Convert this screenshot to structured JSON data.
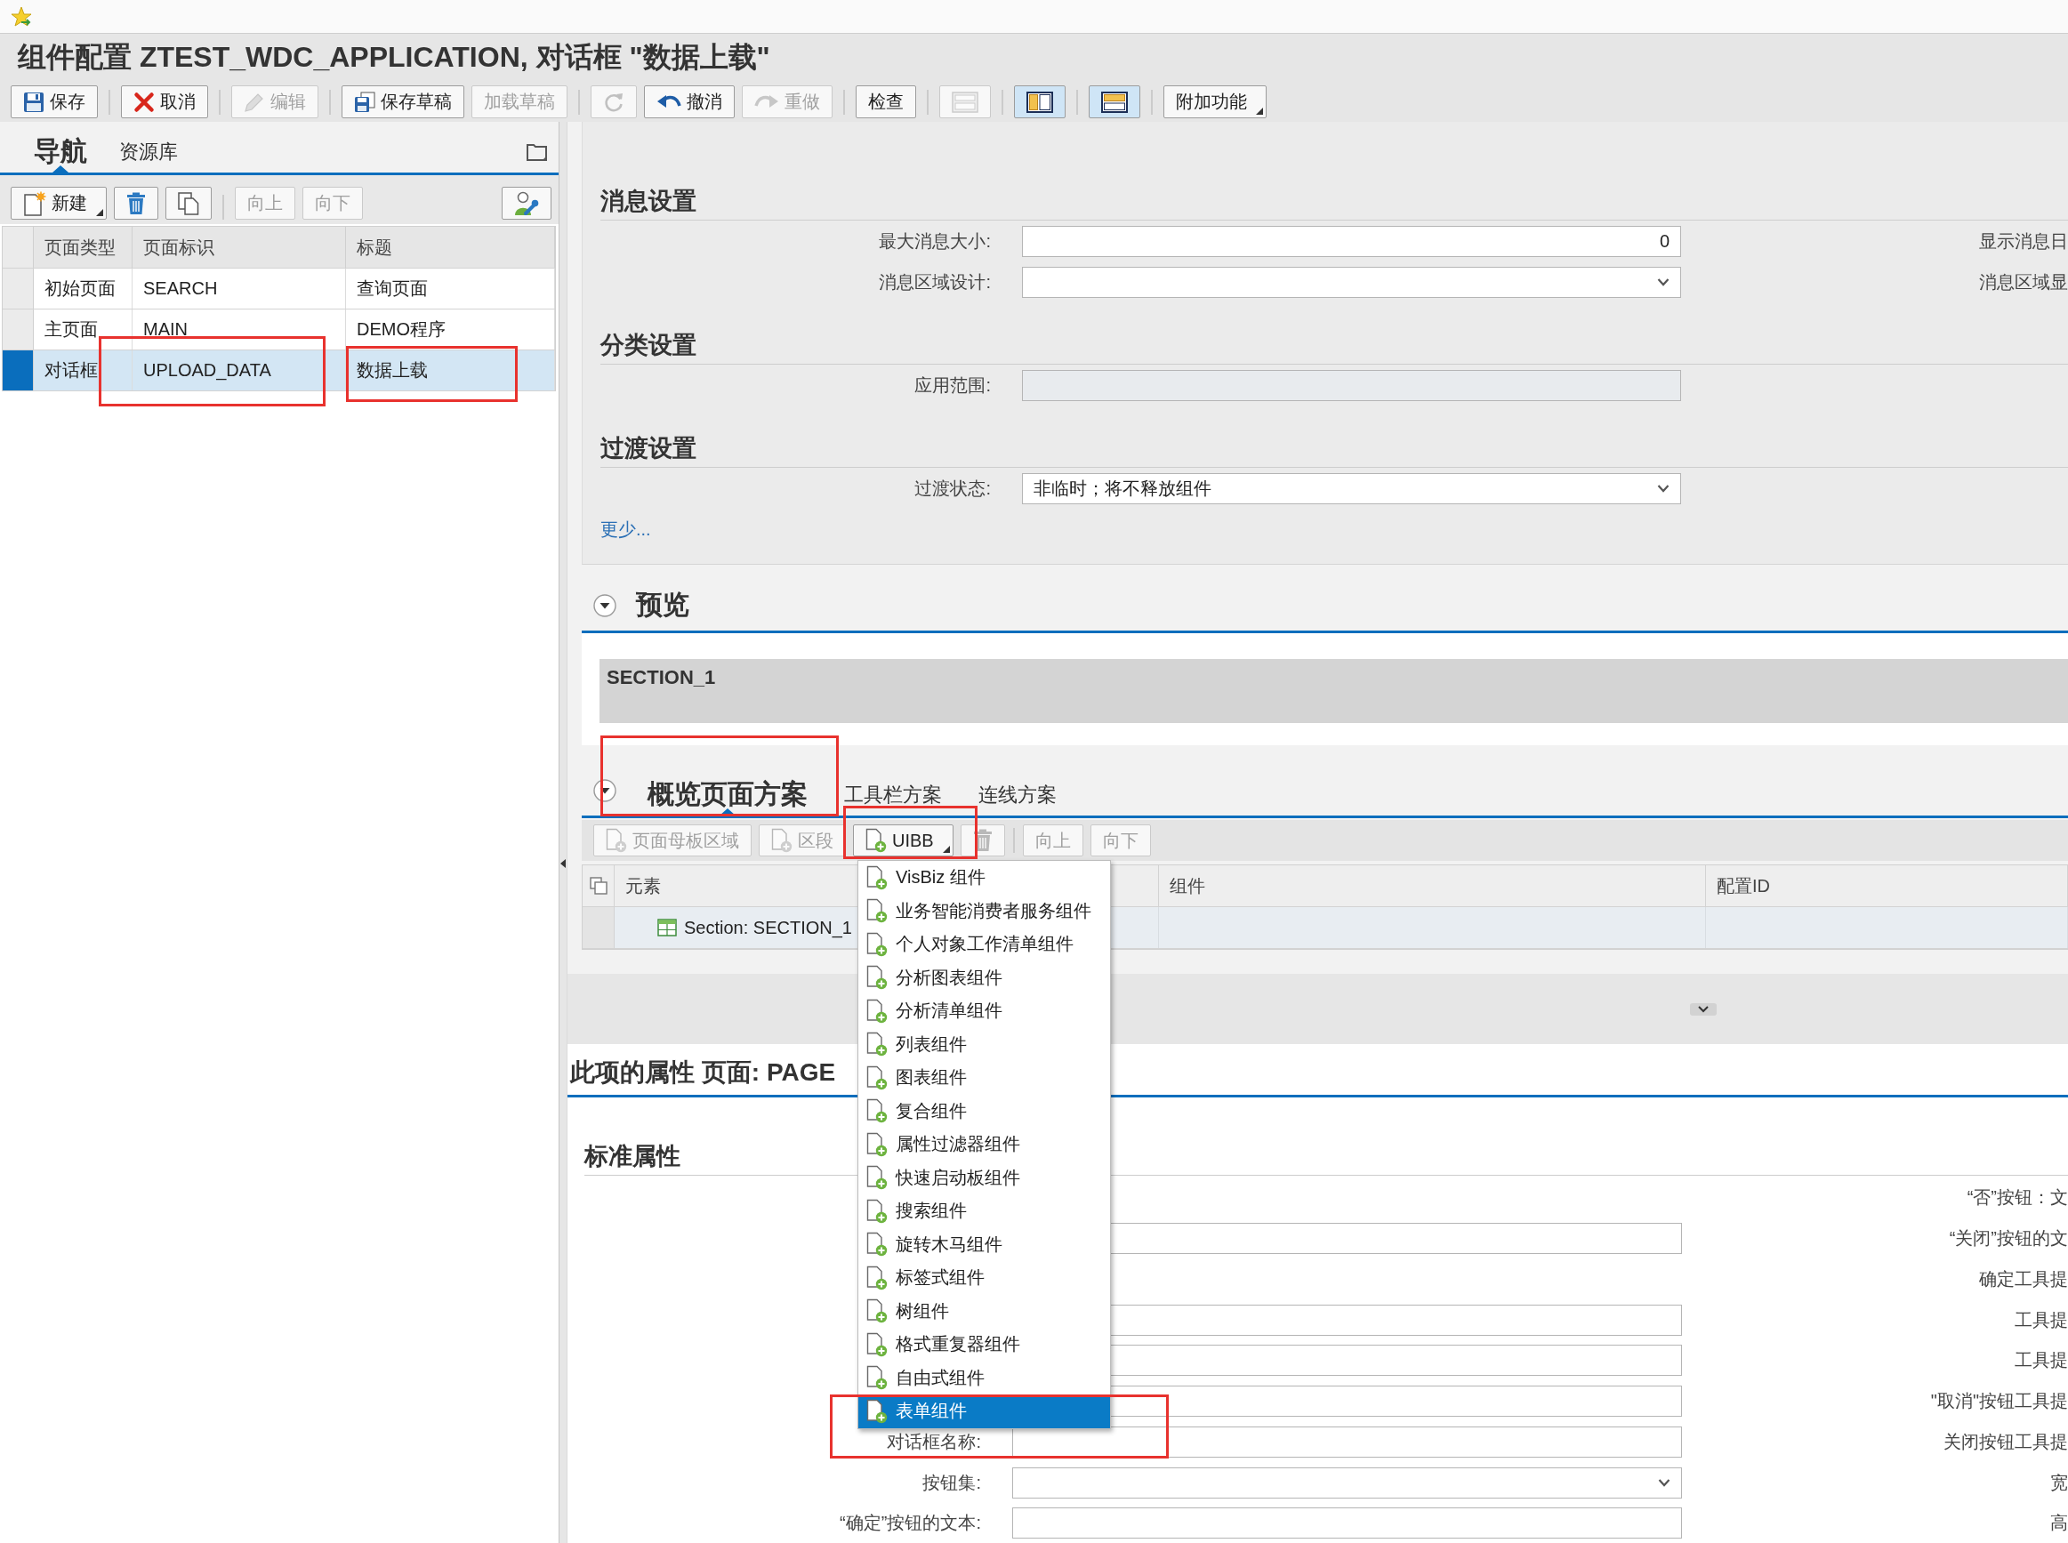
{
  "window": {
    "title": "组件配置 ZTEST_WDC_APPLICATION, 对话框 \"数据上载\""
  },
  "toolbar": {
    "groups": [
      {
        "buttons": [
          {
            "kind": "save",
            "label": "保存",
            "disabled": false,
            "pressed": false,
            "dropdown": false
          }
        ]
      },
      {
        "buttons": [
          {
            "kind": "cancel",
            "label": "取消",
            "disabled": false,
            "pressed": false,
            "dropdown": false
          }
        ]
      },
      {
        "buttons": [
          {
            "kind": "edit",
            "label": "编辑",
            "disabled": true,
            "pressed": false,
            "dropdown": false
          }
        ]
      },
      {
        "buttons": [
          {
            "kind": "save_draft",
            "label": "保存草稿",
            "disabled": false,
            "pressed": false,
            "dropdown": false
          },
          {
            "kind": "text",
            "label": "加载草稿",
            "disabled": true,
            "pressed": false,
            "dropdown": false
          }
        ]
      },
      {
        "buttons": [
          {
            "kind": "refresh",
            "disabled": true,
            "pressed": false,
            "dropdown": false
          },
          {
            "kind": "undo",
            "label": "撤消",
            "disabled": false,
            "pressed": false,
            "dropdown": false
          },
          {
            "kind": "redo",
            "label": "重做",
            "disabled": true,
            "pressed": false,
            "dropdown": false
          }
        ]
      },
      {
        "buttons": [
          {
            "kind": "text",
            "label": "检查",
            "disabled": false,
            "pressed": false,
            "dropdown": false
          }
        ]
      },
      {
        "buttons": [
          {
            "kind": "layout_rows",
            "disabled": true,
            "pressed": false,
            "dropdown": false
          }
        ]
      },
      {
        "buttons": [
          {
            "kind": "layout_columns",
            "disabled": false,
            "pressed": true,
            "dropdown": false
          }
        ]
      },
      {
        "buttons": [
          {
            "kind": "layout_split",
            "disabled": false,
            "pressed": true,
            "dropdown": false
          }
        ]
      },
      {
        "buttons": [
          {
            "kind": "text",
            "label": "附加功能",
            "disabled": false,
            "pressed": false,
            "dropdown": true
          }
        ]
      }
    ]
  },
  "navigator": {
    "tabs": [
      {
        "label": "导航",
        "selected": true
      },
      {
        "label": "资源库",
        "selected": false
      }
    ],
    "toolbar": {
      "groups": [
        {
          "buttons": [
            {
              "kind": "new",
              "label": "新建",
              "disabled": false,
              "dropdown": true
            },
            {
              "kind": "delete",
              "disabled": false,
              "dropdown": false
            },
            {
              "kind": "copy",
              "disabled": false,
              "dropdown": false
            }
          ]
        },
        {
          "buttons": [
            {
              "kind": "text",
              "label": "向上",
              "disabled": true,
              "dropdown": false
            },
            {
              "kind": "text",
              "label": "向下",
              "disabled": true,
              "dropdown": false
            }
          ]
        }
      ],
      "end_buttons": [
        {
          "kind": "personalize",
          "disabled": false,
          "dropdown": false
        }
      ]
    },
    "table": {
      "columns": [
        "页面类型",
        "页面标识",
        "标题"
      ],
      "rows": [
        {
          "cells": [
            "初始页面",
            "SEARCH",
            "查询页面"
          ],
          "selected": false
        },
        {
          "cells": [
            "主页面",
            "MAIN",
            "DEMO程序"
          ],
          "selected": false
        },
        {
          "cells": [
            "对话框",
            "UPLOAD_DATA",
            "数据上载"
          ],
          "selected": true
        }
      ]
    }
  },
  "settings": {
    "groups": [
      {
        "title": "消息设置",
        "rows": [
          {
            "label": "最大消息大小:",
            "kind": "number",
            "value": "0",
            "disabled": false,
            "side_label": "显示消息日"
          },
          {
            "label": "消息区域设计:",
            "kind": "select",
            "disabled": false,
            "side_label": "消息区域显"
          }
        ]
      },
      {
        "title": "分类设置",
        "rows": [
          {
            "label": "应用范围:",
            "kind": "input",
            "disabled": true
          }
        ]
      },
      {
        "title": "过渡设置",
        "rows": [
          {
            "label": "过渡状态:",
            "kind": "select",
            "value": "非临时；将不释放组件",
            "disabled": false
          }
        ]
      }
    ],
    "link": "更少..."
  },
  "preview": {
    "title": "预览",
    "expanded": true,
    "sections": [
      "SECTION_1"
    ]
  },
  "layout": {
    "expanded": true,
    "tabs": [
      {
        "label": "概览页面方案",
        "selected": true
      },
      {
        "label": "工具栏方案",
        "selected": false
      },
      {
        "label": "连线方案",
        "selected": false
      }
    ],
    "toolbar": {
      "groups": [
        {
          "buttons": [
            {
              "kind": "add",
              "label": "页面母板区域",
              "disabled": true,
              "dropdown": false
            },
            {
              "kind": "add",
              "label": "区段",
              "disabled": true,
              "dropdown": false
            },
            {
              "kind": "add",
              "label": "UIBB",
              "disabled": false,
              "dropdown": true
            },
            {
              "kind": "delete",
              "disabled": true,
              "dropdown": false
            }
          ]
        },
        {
          "buttons": [
            {
              "kind": "text",
              "label": "向上",
              "disabled": true,
              "dropdown": false
            },
            {
              "kind": "text",
              "label": "向下",
              "disabled": true,
              "dropdown": false
            }
          ]
        }
      ]
    },
    "table": {
      "columns": [
        "元素",
        "组件",
        "配置ID"
      ],
      "rows": [
        {
          "element": "Section: SECTION_1"
        }
      ]
    }
  },
  "properties": {
    "title": "此项的属性 页面: PAGE",
    "subtitle": "标准属性",
    "rows": [
      {
        "kind": "blank",
        "side_label": "“否”按钮：文"
      },
      {
        "kind": "input",
        "side_label": "“关闭”按钮的文"
      },
      {
        "kind": "blank",
        "side_label": "确定工具提"
      },
      {
        "kind": "input",
        "side_label": "工具提"
      },
      {
        "kind": "input",
        "side_label": "工具提"
      },
      {
        "kind": "input",
        "side_label": "\"取消\"按钮工具提"
      },
      {
        "kind": "input",
        "label": "对话框名称:",
        "side_label": "关闭按钮工具提"
      },
      {
        "kind": "select",
        "label": "按钮集:",
        "side_label": "宽"
      },
      {
        "kind": "input",
        "label": "“确定”按钮的文本:",
        "side_label": "高"
      }
    ]
  },
  "uibb_menu": {
    "items": [
      {
        "label": "VisBiz 组件",
        "selected": false
      },
      {
        "label": "业务智能消费者服务组件",
        "selected": false
      },
      {
        "label": "个人对象工作清单组件",
        "selected": false
      },
      {
        "label": "分析图表组件",
        "selected": false
      },
      {
        "label": "分析清单组件",
        "selected": false
      },
      {
        "label": "列表组件",
        "selected": false
      },
      {
        "label": "图表组件",
        "selected": false
      },
      {
        "label": "复合组件",
        "selected": false
      },
      {
        "label": "属性过滤器组件",
        "selected": false
      },
      {
        "label": "快速启动板组件",
        "selected": false
      },
      {
        "label": "搜索组件",
        "selected": false
      },
      {
        "label": "旋转木马组件",
        "selected": false
      },
      {
        "label": "标签式组件",
        "selected": false
      },
      {
        "label": "树组件",
        "selected": false
      },
      {
        "label": "格式重复器组件",
        "selected": false
      },
      {
        "label": "自由式组件",
        "selected": false
      },
      {
        "label": "表单组件",
        "selected": true
      }
    ]
  }
}
